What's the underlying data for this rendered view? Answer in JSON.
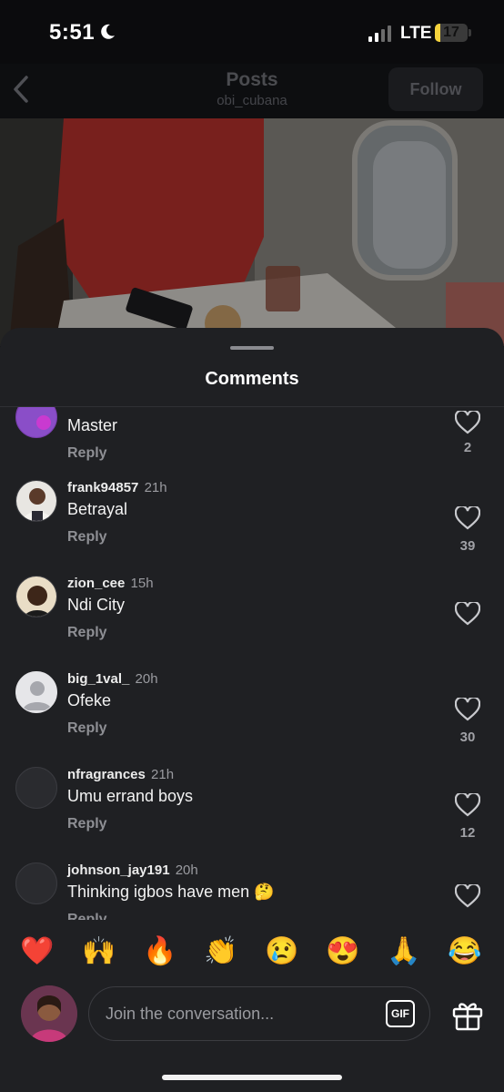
{
  "status_bar": {
    "time": "5:51",
    "network": "LTE",
    "battery": "17"
  },
  "header": {
    "title": "Posts",
    "subtitle": "obi_cubana",
    "follow_label": "Follow"
  },
  "sheet": {
    "title": "Comments"
  },
  "comments": [
    {
      "username": "",
      "time": "",
      "text": "Master",
      "reply_label": "Reply",
      "likes": "2",
      "avatar": "purple-avatar"
    },
    {
      "username": "frank94857",
      "time": "21h",
      "text": "Betrayal",
      "reply_label": "Reply",
      "likes": "39",
      "avatar": "photo-avatar"
    },
    {
      "username": "zion_cee",
      "time": "15h",
      "text": "Ndi City",
      "reply_label": "Reply",
      "likes": "",
      "avatar": "photo-avatar"
    },
    {
      "username": "big_1val_",
      "time": "20h",
      "text": "Ofeke",
      "reply_label": "Reply",
      "likes": "30",
      "avatar": "default-avatar"
    },
    {
      "username": "nfragrances",
      "time": "21h",
      "text": "Umu errand boys",
      "reply_label": "Reply",
      "likes": "12",
      "avatar": "empty-avatar"
    },
    {
      "username": "johnson_jay191",
      "time": "20h",
      "text": "Thinking igbos have men 🤔",
      "reply_label": "Reply",
      "likes": "",
      "avatar": "empty-avatar"
    }
  ],
  "emojis": [
    "❤️",
    "🙌",
    "🔥",
    "👏",
    "😢",
    "😍",
    "🙏",
    "😂"
  ],
  "composer": {
    "placeholder": "Join the conversation...",
    "gif_label": "GIF"
  },
  "colors": {
    "sheet_bg": "#1f2023",
    "accent_battery": "#f4d23c"
  }
}
